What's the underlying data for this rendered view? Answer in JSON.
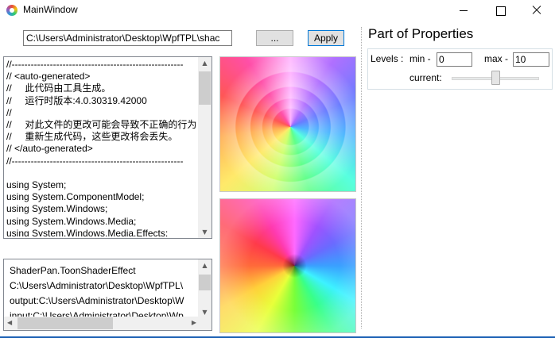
{
  "window": {
    "title": "MainWindow"
  },
  "toolbar": {
    "path_value": "C:\\Users\\Administrator\\Desktop\\WpfTPL\\shac",
    "browse_label": "...",
    "apply_label": "Apply"
  },
  "code_editor": {
    "text": "//------------------------------------------------------\n// <auto-generated>\n//     此代码由工具生成。\n//     运行时版本:4.0.30319.42000\n//\n//     对此文件的更改可能会导致不正确的行为\n//     重新生成代码，这些更改将会丢失。\n// </auto-generated>\n//------------------------------------------------------\n\nusing System;\nusing System.ComponentModel;\nusing System.Windows;\nusing System.Windows.Media;\nusing System.Windows.Media.Effects;"
  },
  "log": {
    "text": "ShaderPan.ToonShaderEffect\nC:\\Users\\Administrator\\Desktop\\WpfTPL\\\noutput:C:\\Users\\Administrator\\Desktop\\W\ninput:C:\\Users\\Administrator\\Desktop\\Wp"
  },
  "properties": {
    "title": "Part of Properties",
    "levels_label": "Levels :",
    "min_label": "min -",
    "min_value": "0",
    "max_label": "max -",
    "max_value": "10",
    "current_label": "current:",
    "current_fraction": 0.5
  },
  "colors": {
    "apply_border": "#0078d7",
    "taskbar": "#1a5fb4"
  }
}
